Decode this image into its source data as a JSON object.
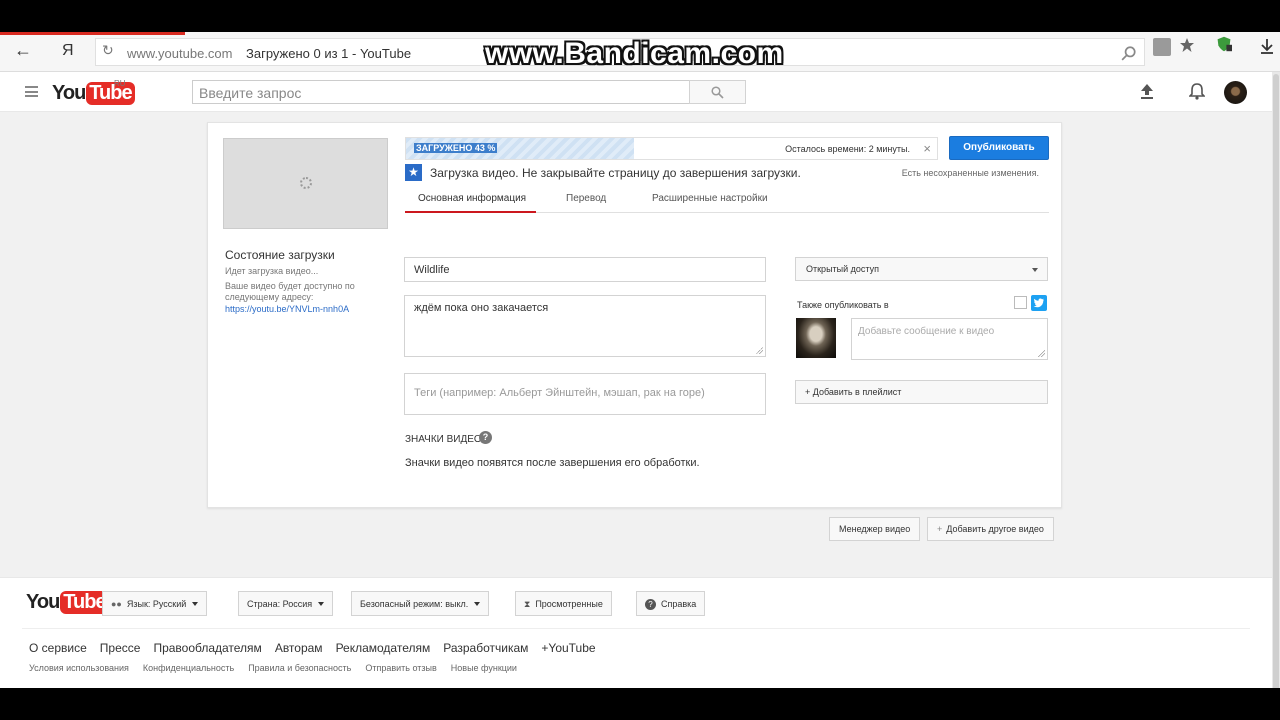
{
  "browser": {
    "back_glyph": "←",
    "yandex_glyph": "Я",
    "reload_glyph": "↻",
    "domain": "www.youtube.com",
    "tab_title": "Загружено 0 из 1 - YouTube",
    "watermark": "www.Bandicam.com"
  },
  "header": {
    "logo_you": "You",
    "logo_tube": "Tube",
    "logo_region": "RU",
    "search_placeholder": "Введите запрос"
  },
  "upload": {
    "progress_label": "ЗАГРУЖЕНО 43 %",
    "progress_fraction": 0.43,
    "time_left": "Осталось времени: 2 минуты.",
    "close_glyph": "×",
    "publish_label": "Опубликовать",
    "status_message": "Загрузка видео. Не закрывайте страницу до завершения загрузки.",
    "unsaved_changes": "Есть несохраненные изменения.",
    "state_title": "Состояние загрузки",
    "state_sub": "Идет загрузка видео...",
    "state_available": "Ваше видео будет доступно по следующему адресу:",
    "state_link": "https://youtu.be/YNVLm-nnh0A",
    "tabs": [
      {
        "label": "Основная информация"
      },
      {
        "label": "Перевод"
      },
      {
        "label": "Расширенные настройки"
      }
    ],
    "title_value": "Wildlife",
    "description_value": "ждём пока оно закачается",
    "tags_placeholder": "Теги (например: Альберт Эйнштейн, мэшап, рак на горе)",
    "privacy_value": "Открытый доступ",
    "also_publish": "Также опубликовать в",
    "share_placeholder": "Добавьте сообщение к видео",
    "playlist_label": "+ Добавить в плейлист",
    "thumbnails_title": "ЗНАЧКИ ВИДЕО",
    "thumbnails_message": "Значки видео появятся после завершения его обработки."
  },
  "actions": {
    "video_manager": "Менеджер видео",
    "add_another": "Добавить другое видео"
  },
  "footer": {
    "language": "Язык: Русский",
    "country": "Страна: Россия",
    "safe_mode": "Безопасный режим: выкл.",
    "history": "Просмотренные",
    "help": "Справка",
    "links": [
      "О сервисе",
      "Прессе",
      "Правообладателям",
      "Авторам",
      "Рекламодателям",
      "Разработчикам",
      "+YouTube"
    ],
    "small_links": [
      "Условия использования",
      "Конфиденциальность",
      "Правила и безопасность",
      "Отправить отзыв",
      "Новые функции"
    ]
  },
  "colors": {
    "accent_red": "#e52d27",
    "publish_blue": "#1b7de0",
    "link_blue": "#2a6bc7"
  }
}
